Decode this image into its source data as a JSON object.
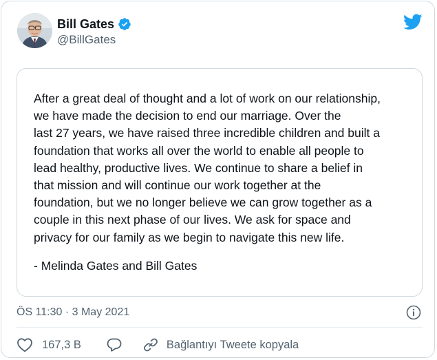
{
  "author": {
    "display_name": "Bill Gates",
    "handle": "@BillGates",
    "verified": true,
    "avatar": "profile-photo"
  },
  "statement": {
    "lines": [
      "After a great deal of thought and a lot of work on our relationship,",
      "we have made the decision to end our marriage. Over the",
      "last 27 years, we have raised three incredible children and built a",
      "foundation that works all over the world to enable all people to",
      "lead healthy, productive lives. We continue to share a belief in",
      "that mission and will continue our work together at the",
      "foundation, but we no longer believe we can grow together as a",
      "couple in this next phase of our lives. We ask for space and",
      "privacy for our family as we begin to navigate this new life."
    ],
    "signature": "- Melinda Gates and Bill Gates"
  },
  "meta": {
    "timestamp": "ÖS 11:30 · 3 May 2021"
  },
  "actions": {
    "like_count": "167,3 B",
    "copy_link_label": "Bağlantıyı Tweete kopyala"
  },
  "icons": {
    "brand": "twitter-bird-icon",
    "verified": "verified-badge-icon",
    "info": "info-icon",
    "like": "heart-icon",
    "reply": "speech-bubble-icon",
    "copy_link": "link-icon"
  },
  "colors": {
    "twitter_blue": "#1da1f2",
    "text_primary": "#0f1419",
    "text_secondary": "#536471",
    "border": "#cfd9de"
  }
}
